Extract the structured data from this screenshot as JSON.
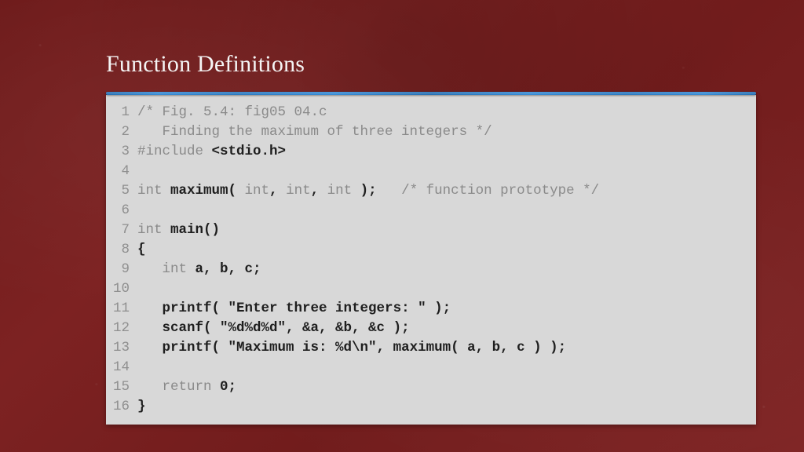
{
  "title": "Function Definitions",
  "code": {
    "lines": [
      {
        "n": "1",
        "segs": [
          {
            "cls": "cm",
            "t": "/* Fig. 5.4: fig05 04.c"
          }
        ]
      },
      {
        "n": "2",
        "segs": [
          {
            "cls": "cm",
            "t": "   Finding the maximum of three integers */"
          }
        ]
      },
      {
        "n": "3",
        "segs": [
          {
            "cls": "kw",
            "t": "#include "
          },
          {
            "cls": "bk",
            "t": "<stdio.h>"
          }
        ]
      },
      {
        "n": "4",
        "segs": [
          {
            "cls": "pl",
            "t": ""
          }
        ]
      },
      {
        "n": "5",
        "segs": [
          {
            "cls": "kw",
            "t": "int "
          },
          {
            "cls": "bk",
            "t": "maximum( "
          },
          {
            "cls": "kw",
            "t": "int"
          },
          {
            "cls": "bk",
            "t": ", "
          },
          {
            "cls": "kw",
            "t": "int"
          },
          {
            "cls": "bk",
            "t": ", "
          },
          {
            "cls": "kw",
            "t": "int"
          },
          {
            "cls": "bk",
            "t": " );   "
          },
          {
            "cls": "cm",
            "t": "/* function prototype */"
          }
        ]
      },
      {
        "n": "6",
        "segs": [
          {
            "cls": "pl",
            "t": ""
          }
        ]
      },
      {
        "n": "7",
        "segs": [
          {
            "cls": "kw",
            "t": "int "
          },
          {
            "cls": "bk",
            "t": "main()"
          }
        ]
      },
      {
        "n": "8",
        "segs": [
          {
            "cls": "bk",
            "t": "{"
          }
        ]
      },
      {
        "n": "9",
        "segs": [
          {
            "cls": "pl",
            "t": "   "
          },
          {
            "cls": "kw",
            "t": "int "
          },
          {
            "cls": "bk",
            "t": "a, b, c;"
          }
        ]
      },
      {
        "n": "10",
        "segs": [
          {
            "cls": "pl",
            "t": ""
          }
        ]
      },
      {
        "n": "11",
        "segs": [
          {
            "cls": "pl",
            "t": "   "
          },
          {
            "cls": "bk",
            "t": "printf( \"Enter three integers: \" );"
          }
        ]
      },
      {
        "n": "12",
        "segs": [
          {
            "cls": "pl",
            "t": "   "
          },
          {
            "cls": "bk",
            "t": "scanf( \"%d%d%d\", &a, &b, &c );"
          }
        ]
      },
      {
        "n": "13",
        "segs": [
          {
            "cls": "pl",
            "t": "   "
          },
          {
            "cls": "bk",
            "t": "printf( \"Maximum is: %d\\n\", maximum( a, b, c ) );"
          }
        ]
      },
      {
        "n": "14",
        "segs": [
          {
            "cls": "pl",
            "t": ""
          }
        ]
      },
      {
        "n": "15",
        "segs": [
          {
            "cls": "pl",
            "t": "   "
          },
          {
            "cls": "kw",
            "t": "return "
          },
          {
            "cls": "bk",
            "t": "0;"
          }
        ]
      },
      {
        "n": "16",
        "segs": [
          {
            "cls": "bk",
            "t": "}"
          }
        ]
      }
    ]
  }
}
